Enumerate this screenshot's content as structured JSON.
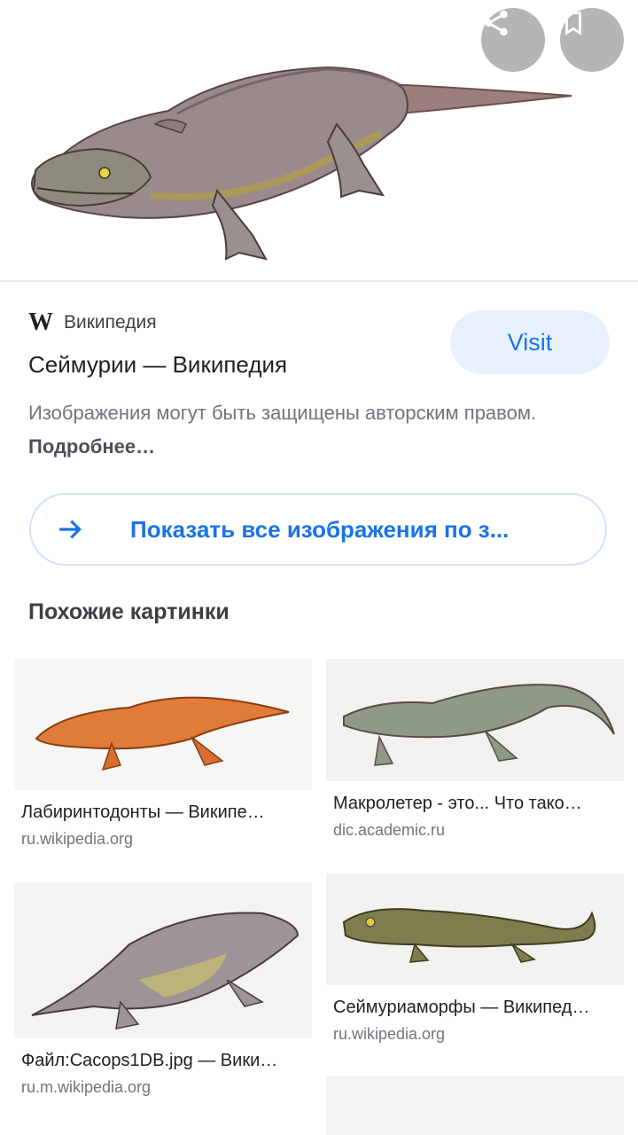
{
  "hero": {
    "image": "seymouria-illustration",
    "share_icon": "share-icon",
    "bookmark_icon": "bookmark-icon"
  },
  "source": {
    "logo": "W",
    "name": "Википедия"
  },
  "visit_button": "Visit",
  "result_title": "Сеймурии — Википедия",
  "copyright": {
    "text": "Изображения могут быть защищены авторским правом.",
    "link": "Подробнее…"
  },
  "show_all": {
    "label": "Показать все изображения по з...",
    "icon": "arrow-right-icon"
  },
  "similar": {
    "title": "Похожие картинки",
    "items": [
      {
        "title": "Лабиринтодонты — Википе…",
        "domain": "ru.wikipedia.org"
      },
      {
        "title": "Макролетер - это... Что тако…",
        "domain": "dic.academic.ru"
      },
      {
        "title": "Файл:Cacops1DB.jpg — Вики…",
        "domain": "ru.m.wikipedia.org"
      },
      {
        "title": "Сеймуриаморфы — Википед…",
        "domain": "ru.wikipedia.org"
      }
    ]
  },
  "colors": {
    "accent": "#1a73e8",
    "visit_bg": "#e8f0fe",
    "muted": "#70757a"
  }
}
